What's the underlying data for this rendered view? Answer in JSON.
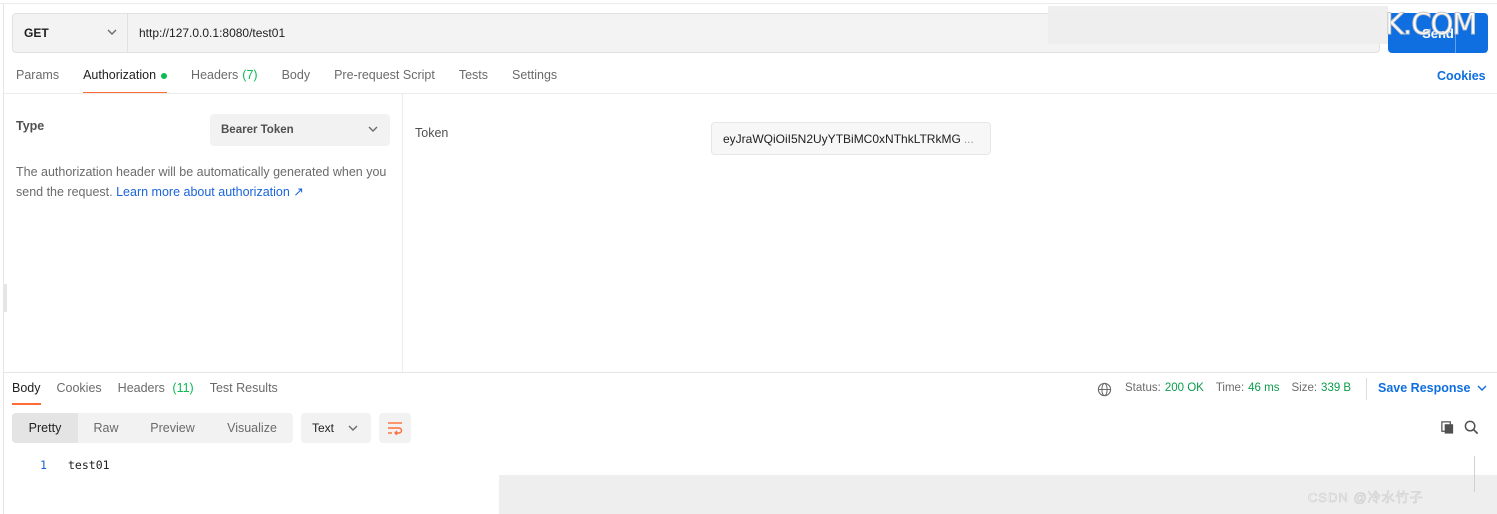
{
  "request": {
    "method": "GET",
    "url": "http://127.0.0.1:8080/test01",
    "send_label": "Send"
  },
  "watermark": {
    "top": "K.COM",
    "bottom": "CSDN @冷水竹子"
  },
  "request_tabs": {
    "params": "Params",
    "authorization": "Authorization",
    "headers": "Headers",
    "headers_count": "(7)",
    "body": "Body",
    "prerequest": "Pre-request Script",
    "tests": "Tests",
    "settings": "Settings",
    "cookies": "Cookies"
  },
  "auth": {
    "type_label": "Type",
    "type_value": "Bearer Token",
    "description": "The authorization header will be automatically generated when you send the request.",
    "learn_more": "Learn more about authorization ↗",
    "token_label": "Token",
    "token_value": "eyJraWQiOiI5N2UyYTBiMC0xNThkLTRkMG",
    "token_ellipsis": "..."
  },
  "response": {
    "tabs": {
      "body": "Body",
      "cookies": "Cookies",
      "headers": "Headers",
      "headers_count": "(11)",
      "test_results": "Test Results"
    },
    "status_label": "Status:",
    "status_value": "200 OK",
    "time_label": "Time:",
    "time_value": "46 ms",
    "size_label": "Size:",
    "size_value": "339 B",
    "save_label": "Save Response",
    "views": {
      "pretty": "Pretty",
      "raw": "Raw",
      "preview": "Preview",
      "visualize": "Visualize"
    },
    "format": "Text",
    "lines": [
      {
        "num": "1",
        "text": "test01"
      }
    ]
  },
  "colors": {
    "accent": "#ff6c37",
    "primary": "#0f6fe0",
    "success": "#0cbb52"
  },
  "icons": [
    "chevron-down-icon",
    "globe-icon",
    "wrap-lines-icon",
    "copy-icon",
    "search-icon",
    "external-link-icon"
  ]
}
